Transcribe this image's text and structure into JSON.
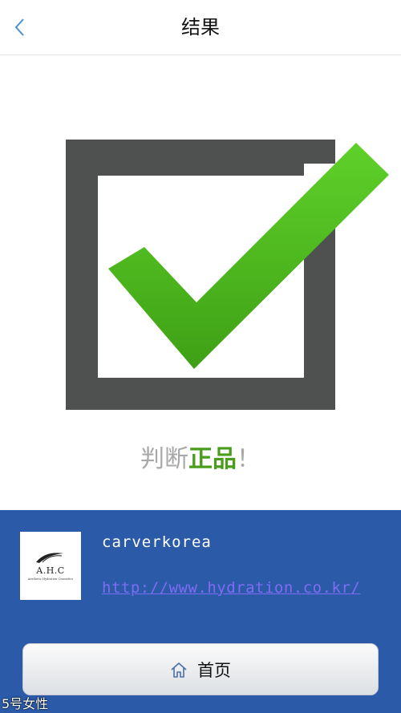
{
  "header": {
    "title": "结果",
    "back_icon": "chevron-left-icon"
  },
  "result": {
    "icon": "check-box-icon",
    "verdict_prefix": "判断",
    "verdict_highlight": "正品",
    "verdict_suffix": "！",
    "colors": {
      "box": "#4f5150",
      "check": "#4fb81f"
    }
  },
  "brand": {
    "logo_text": "A.H.C",
    "logo_subtext": "Aesthetic Hydration Cosmetics",
    "name": "carverkorea",
    "url": "http://www.hydration.co.kr/"
  },
  "footer": {
    "home_label": "首页",
    "home_icon": "home-icon"
  },
  "watermark": "5号女性",
  "colors": {
    "panel": "#2a5aa8",
    "link": "#7f6cf2"
  }
}
